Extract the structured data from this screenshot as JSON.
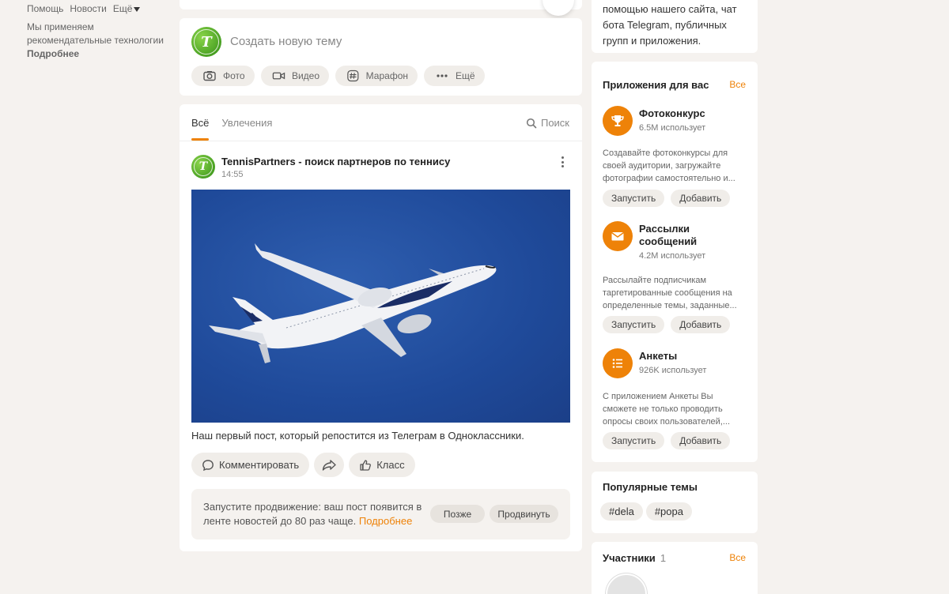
{
  "left": {
    "links": [
      "Помощь",
      "Новости",
      "Ещё"
    ],
    "tech_text_1": "Мы применяем",
    "tech_text_2": "рекомендательные технологии",
    "more": "Подробнее"
  },
  "create": {
    "placeholder": "Создать новую тему",
    "pills": [
      {
        "label": "Фото",
        "icon": "camera-icon"
      },
      {
        "label": "Видео",
        "icon": "video-icon"
      },
      {
        "label": "Марафон",
        "icon": "hashtag-icon"
      },
      {
        "label": "Ещё",
        "icon": "more-dots-icon"
      }
    ]
  },
  "feed": {
    "tabs": [
      "Всё",
      "Увлечения"
    ],
    "search": "Поиск",
    "post": {
      "author": "TennisPartners - поиск партнеров по теннису",
      "time": "14:55",
      "text": "Наш первый пост, который репостится из Телеграм в Одноклассники.",
      "comment": "Комментировать",
      "like": "Класс"
    },
    "promo": {
      "text": "Запустите продвижение: ваш пост появится в ленте новостей до 80 раз чаще.",
      "link": "Подробнее",
      "later": "Позже",
      "promote": "Продвинуть"
    }
  },
  "right": {
    "top_text": [
      "помощью нашего сайта, чат",
      "бота Telegram, публичных",
      "групп и приложения."
    ],
    "apps_title": "Приложения для вас",
    "all": "Все",
    "launch": "Запустить",
    "add": "Добавить",
    "apps": [
      {
        "name": "Фотоконкурс",
        "users": "6.5M использует",
        "desc": "Создавайте фотоконкурсы для своей аудитории, загружайте фотографии самостоятельно и...",
        "icon": "trophy-icon"
      },
      {
        "name": "Рассылки сообщений",
        "users": "4.2M использует",
        "desc": "Рассылайте подписчикам таргетированные сообщения на определенные темы, заданные...",
        "icon": "envelope-icon"
      },
      {
        "name": "Анкеты",
        "users": "926K использует",
        "desc": "С приложением Анкеты Вы сможете не только проводить опросы своих пользователей,...",
        "icon": "list-icon"
      }
    ],
    "topics_title": "Популярные темы",
    "tags": [
      "#dela",
      "#popa"
    ],
    "members_title": "Участники",
    "members_count": "1"
  },
  "colors": {
    "accent": "#ee8208",
    "background": "#f5f2ef"
  }
}
